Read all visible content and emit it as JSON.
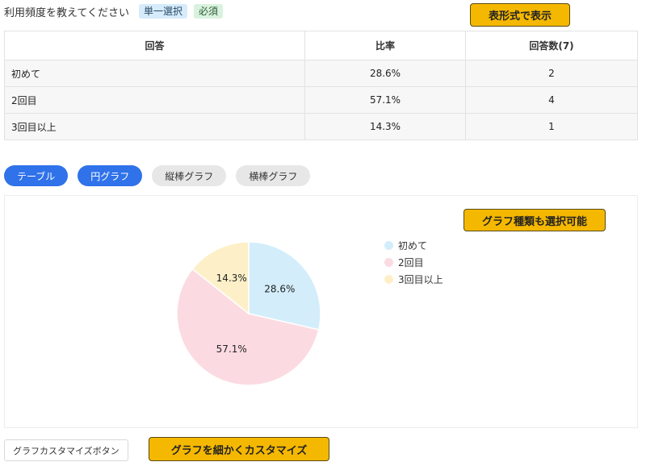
{
  "question": {
    "title": "利用頻度を教えてください",
    "tags": {
      "single": "単一選択",
      "required": "必須"
    }
  },
  "callouts": {
    "table": "表形式で表示",
    "chart_types": "グラフ種類も選択可能",
    "customize": "グラフを細かくカスタマイズ"
  },
  "table": {
    "headers": [
      "回答",
      "比率",
      "回答数(7)"
    ],
    "rows": [
      {
        "answer": "初めて",
        "rate": "28.6%",
        "count": "2"
      },
      {
        "answer": "2回目",
        "rate": "57.1%",
        "count": "4"
      },
      {
        "answer": "3回目以上",
        "rate": "14.3%",
        "count": "1"
      }
    ]
  },
  "tabs": [
    {
      "label": "テーブル",
      "active": true
    },
    {
      "label": "円グラフ",
      "active": true
    },
    {
      "label": "縦棒グラフ",
      "active": false
    },
    {
      "label": "横棒グラフ",
      "active": false
    }
  ],
  "chart_data": {
    "type": "pie",
    "categories": [
      "初めて",
      "2回目",
      "3回目以上"
    ],
    "values": [
      28.6,
      57.1,
      14.3
    ],
    "labels": [
      "28.6%",
      "57.1%",
      "14.3%"
    ],
    "colors": [
      "#d3edfb",
      "#fbdbe1",
      "#fdf0c8"
    ],
    "legend_position": "right"
  },
  "customize_button": "グラフカスタマイズボタン"
}
